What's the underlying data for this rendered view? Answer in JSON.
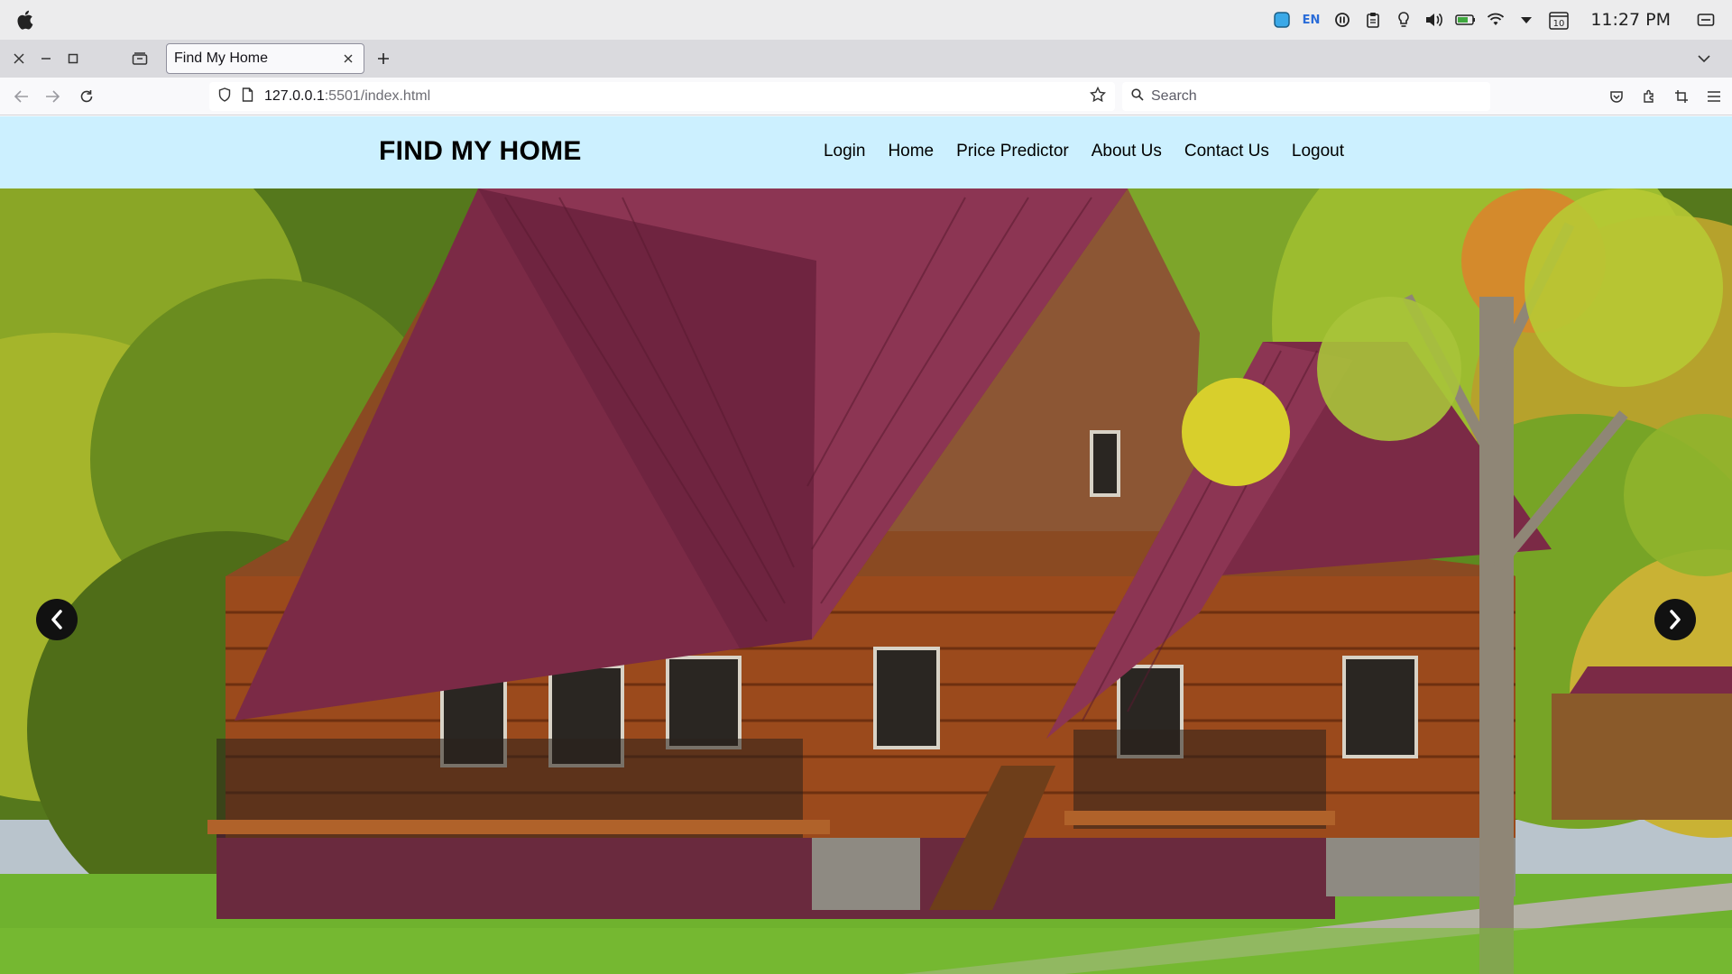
{
  "os": {
    "clock": "11:27 PM",
    "lang": "EN",
    "calendar_day": "10",
    "icons": [
      "apple-icon",
      "app-square-icon",
      "pause-circle-icon",
      "clipboard-icon",
      "bulb-icon",
      "volume-icon",
      "battery-icon",
      "wifi-icon",
      "dropdown-arrow-icon",
      "calendar-icon",
      "window-icon"
    ]
  },
  "browser": {
    "tab_title": "Find My Home",
    "url_host": "127.0.0.1",
    "url_rest": ":5501/index.html",
    "search_placeholder": "Search"
  },
  "site": {
    "brand": "FIND MY HOME",
    "nav": [
      {
        "label": "Login"
      },
      {
        "label": "Home"
      },
      {
        "label": "Price Predictor"
      },
      {
        "label": "About Us"
      },
      {
        "label": "Contact Us"
      },
      {
        "label": "Logout"
      }
    ]
  },
  "colors": {
    "header_bg": "#ccf0ff",
    "roof": "#7b2a46",
    "log_wall": "#9b4a1c",
    "foliage": "#6d9a1e",
    "lawn": "#6fb22e"
  }
}
